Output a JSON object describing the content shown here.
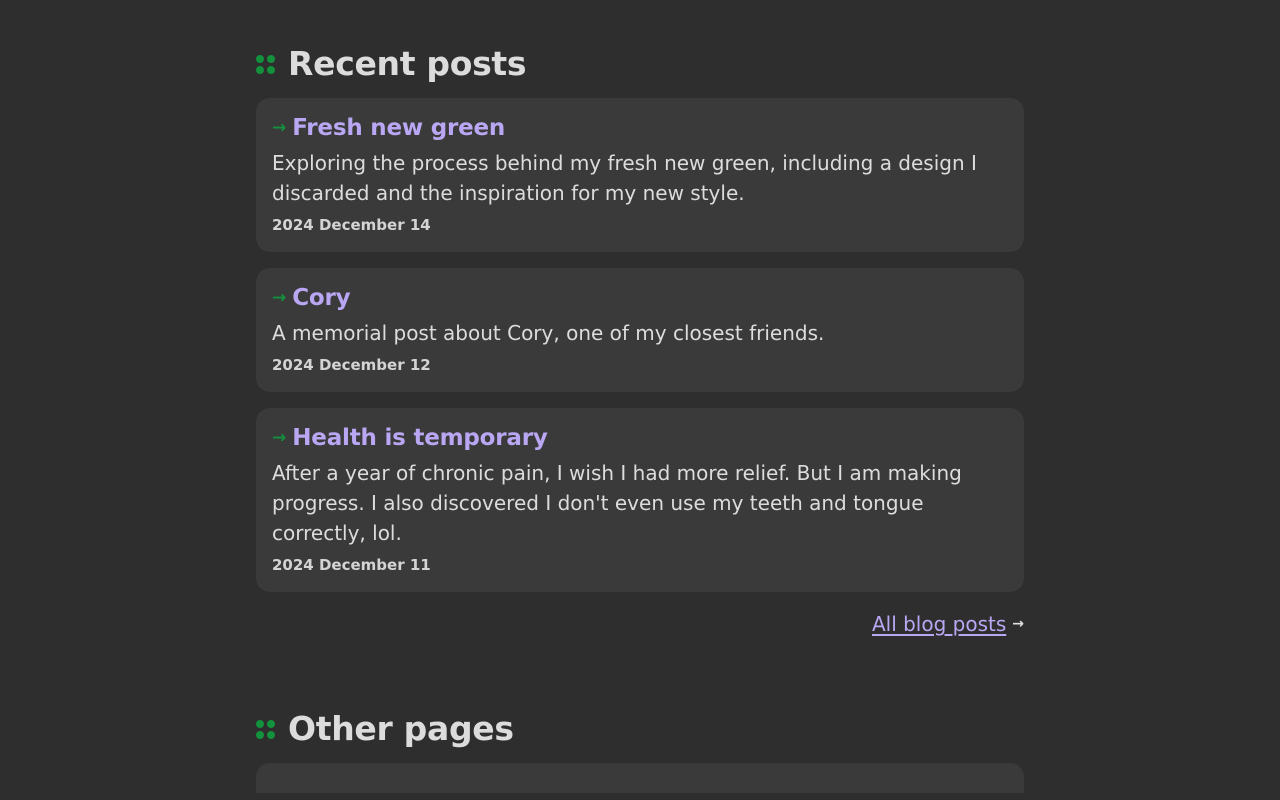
{
  "recent": {
    "heading": "Recent posts",
    "posts": [
      {
        "title": "Fresh new green",
        "description": "Exploring the process behind my fresh new green, including a design I discarded and the inspiration for my new style.",
        "date": "2024 December 14"
      },
      {
        "title": "Cory",
        "description": "A memorial post about Cory, one of my closest friends.",
        "date": "2024 December 12"
      },
      {
        "title": "Health is temporary",
        "description": "After a year of chronic pain, I wish I had more relief. But I am making progress. I also discovered I don't even use my teeth and tongue correctly, lol.",
        "date": "2024 December 11"
      }
    ],
    "all_link_label": "All blog posts",
    "all_link_icon": "arrow-right-icon"
  },
  "other": {
    "heading": "Other pages"
  },
  "colors": {
    "background": "#2e2e2e",
    "card": "#3a3a3a",
    "accent_green": "#13913c",
    "link_purple": "#b9a7f3",
    "text": "#dcdcdc"
  }
}
